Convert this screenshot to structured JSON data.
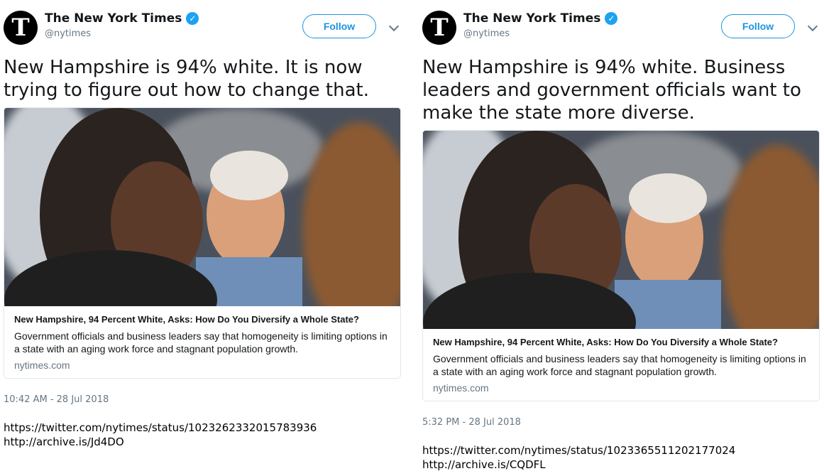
{
  "tweets": [
    {
      "display_name": "The New York Times",
      "verified_glyph": "✓",
      "handle": "@nytimes",
      "follow_label": "Follow",
      "avatar_glyph": "T",
      "text": "New Hampshire is 94% white. It is now trying to figure out how to change that.",
      "card": {
        "title": "New Hampshire, 94 Percent White, Asks: How Do You Diversify a Whole State?",
        "description": "Government officials and business leaders say that homogeneity is limiting options in a state with an aging work force and stagnant population growth.",
        "domain": "nytimes.com"
      },
      "timestamp": "10:42 AM - 28 Jul 2018",
      "links": [
        "https://twitter.com/nytimes/status/1023262332015783936",
        "http://archive.is/Jd4DO"
      ]
    },
    {
      "display_name": "The New York Times",
      "verified_glyph": "✓",
      "handle": "@nytimes",
      "follow_label": "Follow",
      "avatar_glyph": "T",
      "text": "New Hampshire is 94% white. Business leaders and government officials want to make the state more diverse.",
      "card": {
        "title": "New Hampshire, 94 Percent White, Asks: How Do You Diversify a Whole State?",
        "description": "Government officials and business leaders say that homogeneity is limiting options in a state with an aging work force and stagnant population growth.",
        "domain": "nytimes.com"
      },
      "timestamp": "5:32 PM - 28 Jul 2018",
      "links": [
        "https://twitter.com/nytimes/status/1023365511202177024",
        "http://archive.is/CQDFL"
      ]
    }
  ]
}
